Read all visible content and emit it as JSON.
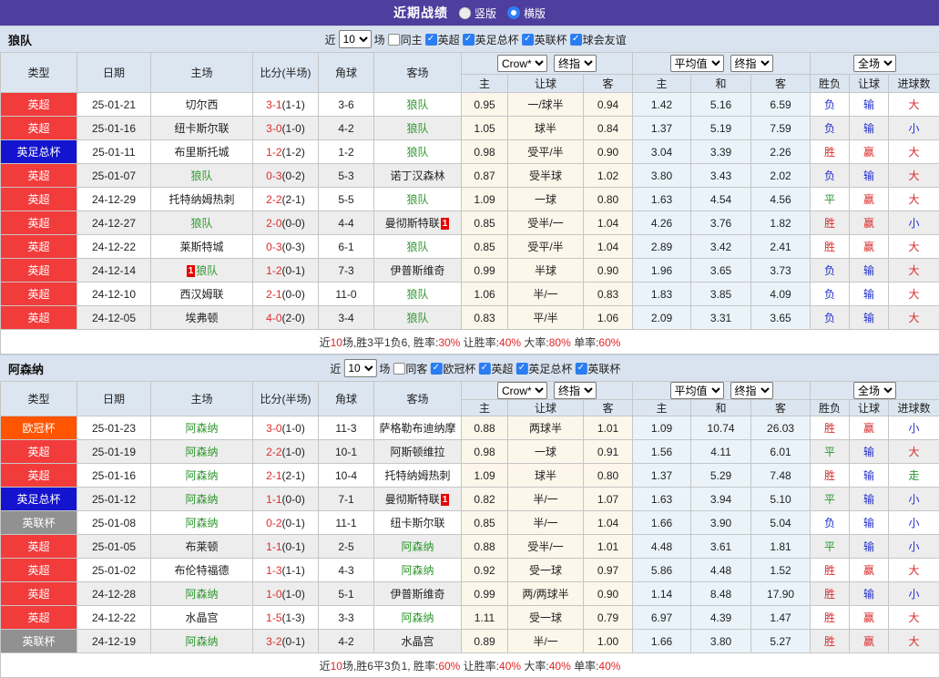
{
  "topbar": {
    "title": "近期战绩",
    "radio_vertical": "竖版",
    "radio_horizontal": "横版",
    "selected_layout": "横版"
  },
  "colors": {
    "accent_purple": "#4e3e9d",
    "section_bar_bg": "#d9e3ef",
    "header_bg": "#dce6f1",
    "row_alt_bg": "#ededed",
    "crow_col_bg": "#fdf6ea",
    "avg_col_bg": "#eaf3fa",
    "score_red": "#e32a2a",
    "focus_team_green": "#2e962e",
    "red_card_bg": "#e60000",
    "checkbox_blue": "#2b7df3",
    "summary_hot": "#e62222",
    "badges": {
      "英超": "#f23b3b",
      "英足总杯": "#1414cf",
      "欧冠杯": "#ff5400",
      "英联杯": "#919191"
    },
    "result_text": {
      "胜": "#d92b2b",
      "平": "#27972c",
      "负": "#2330cc",
      "赢": "#d92b2b",
      "输": "#2330cc",
      "大": "#d92b2b",
      "小": "#2330cc",
      "走": "#27972c"
    }
  },
  "sections": [
    {
      "team": "狼队",
      "controls": {
        "near_label": "近",
        "count": "10",
        "games_label": "场",
        "same_label": "同主",
        "same_checked": false,
        "leagues": [
          "英超",
          "英足总杯",
          "英联杯",
          "球会友谊"
        ]
      },
      "header": {
        "cols": [
          "类型",
          "日期",
          "主场",
          "比分(半场)",
          "角球",
          "客场"
        ],
        "odds_group1": {
          "select1": "Crow*",
          "select2": "终指",
          "subcols": [
            "主",
            "让球",
            "客"
          ]
        },
        "odds_group2": {
          "select1": "平均值",
          "select2": "终指",
          "subcols": [
            "主",
            "和",
            "客"
          ]
        },
        "result_group": {
          "select": "全场",
          "subcols": [
            "胜负",
            "让球",
            "进球数"
          ]
        }
      },
      "rows": [
        {
          "type": "英超",
          "date": "25-01-21",
          "home": {
            "name": "切尔西",
            "focus": false
          },
          "ft": "3-1",
          "ht": "(1-1)",
          "corners": "3-6",
          "away": {
            "name": "狼队",
            "focus": true
          },
          "crow": [
            "0.95",
            "一/球半",
            "0.94"
          ],
          "avg": [
            "1.42",
            "5.16",
            "6.59"
          ],
          "result": [
            "负",
            "输",
            "大"
          ]
        },
        {
          "type": "英超",
          "date": "25-01-16",
          "home": {
            "name": "纽卡斯尔联",
            "focus": false
          },
          "ft": "3-0",
          "ht": "(1-0)",
          "corners": "4-2",
          "away": {
            "name": "狼队",
            "focus": true
          },
          "crow": [
            "1.05",
            "球半",
            "0.84"
          ],
          "avg": [
            "1.37",
            "5.19",
            "7.59"
          ],
          "result": [
            "负",
            "输",
            "小"
          ]
        },
        {
          "type": "英足总杯",
          "date": "25-01-11",
          "home": {
            "name": "布里斯托城",
            "focus": false
          },
          "ft": "1-2",
          "ht": "(1-2)",
          "corners": "1-2",
          "away": {
            "name": "狼队",
            "focus": true
          },
          "crow": [
            "0.98",
            "受平/半",
            "0.90"
          ],
          "avg": [
            "3.04",
            "3.39",
            "2.26"
          ],
          "result": [
            "胜",
            "赢",
            "大"
          ]
        },
        {
          "type": "英超",
          "date": "25-01-07",
          "home": {
            "name": "狼队",
            "focus": true
          },
          "ft": "0-3",
          "ht": "(0-2)",
          "corners": "5-3",
          "away": {
            "name": "诺丁汉森林",
            "focus": false
          },
          "crow": [
            "0.87",
            "受半球",
            "1.02"
          ],
          "avg": [
            "3.80",
            "3.43",
            "2.02"
          ],
          "result": [
            "负",
            "输",
            "大"
          ]
        },
        {
          "type": "英超",
          "date": "24-12-29",
          "home": {
            "name": "托特纳姆热刺",
            "focus": false
          },
          "ft": "2-2",
          "ht": "(2-1)",
          "corners": "5-5",
          "away": {
            "name": "狼队",
            "focus": true
          },
          "crow": [
            "1.09",
            "一球",
            "0.80"
          ],
          "avg": [
            "1.63",
            "4.54",
            "4.56"
          ],
          "result": [
            "平",
            "赢",
            "大"
          ]
        },
        {
          "type": "英超",
          "date": "24-12-27",
          "home": {
            "name": "狼队",
            "focus": true
          },
          "ft": "2-0",
          "ht": "(0-0)",
          "corners": "4-4",
          "away": {
            "name": "曼彻斯特联",
            "focus": false,
            "red": "1",
            "red_pos": "after"
          },
          "crow": [
            "0.85",
            "受半/一",
            "1.04"
          ],
          "avg": [
            "4.26",
            "3.76",
            "1.82"
          ],
          "result": [
            "胜",
            "赢",
            "小"
          ]
        },
        {
          "type": "英超",
          "date": "24-12-22",
          "home": {
            "name": "莱斯特城",
            "focus": false
          },
          "ft": "0-3",
          "ht": "(0-3)",
          "corners": "6-1",
          "away": {
            "name": "狼队",
            "focus": true
          },
          "crow": [
            "0.85",
            "受平/半",
            "1.04"
          ],
          "avg": [
            "2.89",
            "3.42",
            "2.41"
          ],
          "result": [
            "胜",
            "赢",
            "大"
          ]
        },
        {
          "type": "英超",
          "date": "24-12-14",
          "home": {
            "name": "狼队",
            "focus": true,
            "red": "1",
            "red_pos": "before"
          },
          "ft": "1-2",
          "ht": "(0-1)",
          "corners": "7-3",
          "away": {
            "name": "伊普斯维奇",
            "focus": false
          },
          "crow": [
            "0.99",
            "半球",
            "0.90"
          ],
          "avg": [
            "1.96",
            "3.65",
            "3.73"
          ],
          "result": [
            "负",
            "输",
            "大"
          ]
        },
        {
          "type": "英超",
          "date": "24-12-10",
          "home": {
            "name": "西汉姆联",
            "focus": false
          },
          "ft": "2-1",
          "ht": "(0-0)",
          "corners": "11-0",
          "away": {
            "name": "狼队",
            "focus": true
          },
          "crow": [
            "1.06",
            "半/一",
            "0.83"
          ],
          "avg": [
            "1.83",
            "3.85",
            "4.09"
          ],
          "result": [
            "负",
            "输",
            "大"
          ]
        },
        {
          "type": "英超",
          "date": "24-12-05",
          "home": {
            "name": "埃弗顿",
            "focus": false
          },
          "ft": "4-0",
          "ht": "(2-0)",
          "corners": "3-4",
          "away": {
            "name": "狼队",
            "focus": true
          },
          "crow": [
            "0.83",
            "平/半",
            "1.06"
          ],
          "avg": [
            "2.09",
            "3.31",
            "3.65"
          ],
          "result": [
            "负",
            "输",
            "大"
          ]
        }
      ],
      "summary": [
        {
          "t": "近",
          "hot": false
        },
        {
          "t": "10",
          "hot": true
        },
        {
          "t": "场,胜3平1负6, 胜率:",
          "hot": false
        },
        {
          "t": "30%",
          "hot": true
        },
        {
          "t": " 让胜率:",
          "hot": false
        },
        {
          "t": "40%",
          "hot": true
        },
        {
          "t": " 大率:",
          "hot": false
        },
        {
          "t": "80%",
          "hot": true
        },
        {
          "t": " 单率:",
          "hot": false
        },
        {
          "t": "60%",
          "hot": true
        }
      ]
    },
    {
      "team": "阿森纳",
      "controls": {
        "near_label": "近",
        "count": "10",
        "games_label": "场",
        "same_label": "同客",
        "same_checked": false,
        "leagues": [
          "欧冠杯",
          "英超",
          "英足总杯",
          "英联杯"
        ]
      },
      "header": {
        "cols": [
          "类型",
          "日期",
          "主场",
          "比分(半场)",
          "角球",
          "客场"
        ],
        "odds_group1": {
          "select1": "Crow*",
          "select2": "终指",
          "subcols": [
            "主",
            "让球",
            "客"
          ]
        },
        "odds_group2": {
          "select1": "平均值",
          "select2": "终指",
          "subcols": [
            "主",
            "和",
            "客"
          ]
        },
        "result_group": {
          "select": "全场",
          "subcols": [
            "胜负",
            "让球",
            "进球数"
          ]
        }
      },
      "rows": [
        {
          "type": "欧冠杯",
          "date": "25-01-23",
          "home": {
            "name": "阿森纳",
            "focus": true
          },
          "ft": "3-0",
          "ht": "(1-0)",
          "corners": "11-3",
          "away": {
            "name": "萨格勒布迪纳摩",
            "focus": false
          },
          "crow": [
            "0.88",
            "两球半",
            "1.01"
          ],
          "avg": [
            "1.09",
            "10.74",
            "26.03"
          ],
          "result": [
            "胜",
            "赢",
            "小"
          ]
        },
        {
          "type": "英超",
          "date": "25-01-19",
          "home": {
            "name": "阿森纳",
            "focus": true
          },
          "ft": "2-2",
          "ht": "(1-0)",
          "corners": "10-1",
          "away": {
            "name": "阿斯顿维拉",
            "focus": false
          },
          "crow": [
            "0.98",
            "一球",
            "0.91"
          ],
          "avg": [
            "1.56",
            "4.11",
            "6.01"
          ],
          "result": [
            "平",
            "输",
            "大"
          ]
        },
        {
          "type": "英超",
          "date": "25-01-16",
          "home": {
            "name": "阿森纳",
            "focus": true
          },
          "ft": "2-1",
          "ht": "(2-1)",
          "corners": "10-4",
          "away": {
            "name": "托特纳姆热刺",
            "focus": false
          },
          "crow": [
            "1.09",
            "球半",
            "0.80"
          ],
          "avg": [
            "1.37",
            "5.29",
            "7.48"
          ],
          "result": [
            "胜",
            "输",
            "走"
          ]
        },
        {
          "type": "英足总杯",
          "date": "25-01-12",
          "home": {
            "name": "阿森纳",
            "focus": true
          },
          "ft": "1-1",
          "ht": "(0-0)",
          "corners": "7-1",
          "away": {
            "name": "曼彻斯特联",
            "focus": false,
            "red": "1",
            "red_pos": "after"
          },
          "crow": [
            "0.82",
            "半/一",
            "1.07"
          ],
          "avg": [
            "1.63",
            "3.94",
            "5.10"
          ],
          "result": [
            "平",
            "输",
            "小"
          ]
        },
        {
          "type": "英联杯",
          "date": "25-01-08",
          "home": {
            "name": "阿森纳",
            "focus": true
          },
          "ft": "0-2",
          "ht": "(0-1)",
          "corners": "11-1",
          "away": {
            "name": "纽卡斯尔联",
            "focus": false
          },
          "crow": [
            "0.85",
            "半/一",
            "1.04"
          ],
          "avg": [
            "1.66",
            "3.90",
            "5.04"
          ],
          "result": [
            "负",
            "输",
            "小"
          ]
        },
        {
          "type": "英超",
          "date": "25-01-05",
          "home": {
            "name": "布莱顿",
            "focus": false
          },
          "ft": "1-1",
          "ht": "(0-1)",
          "corners": "2-5",
          "away": {
            "name": "阿森纳",
            "focus": true
          },
          "crow": [
            "0.88",
            "受半/一",
            "1.01"
          ],
          "avg": [
            "4.48",
            "3.61",
            "1.81"
          ],
          "result": [
            "平",
            "输",
            "小"
          ]
        },
        {
          "type": "英超",
          "date": "25-01-02",
          "home": {
            "name": "布伦特福德",
            "focus": false
          },
          "ft": "1-3",
          "ht": "(1-1)",
          "corners": "4-3",
          "away": {
            "name": "阿森纳",
            "focus": true
          },
          "crow": [
            "0.92",
            "受一球",
            "0.97"
          ],
          "avg": [
            "5.86",
            "4.48",
            "1.52"
          ],
          "result": [
            "胜",
            "赢",
            "大"
          ]
        },
        {
          "type": "英超",
          "date": "24-12-28",
          "home": {
            "name": "阿森纳",
            "focus": true
          },
          "ft": "1-0",
          "ht": "(1-0)",
          "corners": "5-1",
          "away": {
            "name": "伊普斯维奇",
            "focus": false
          },
          "crow": [
            "0.99",
            "两/两球半",
            "0.90"
          ],
          "avg": [
            "1.14",
            "8.48",
            "17.90"
          ],
          "result": [
            "胜",
            "输",
            "小"
          ]
        },
        {
          "type": "英超",
          "date": "24-12-22",
          "home": {
            "name": "水晶宫",
            "focus": false
          },
          "ft": "1-5",
          "ht": "(1-3)",
          "corners": "3-3",
          "away": {
            "name": "阿森纳",
            "focus": true
          },
          "crow": [
            "1.11",
            "受一球",
            "0.79"
          ],
          "avg": [
            "6.97",
            "4.39",
            "1.47"
          ],
          "result": [
            "胜",
            "赢",
            "大"
          ]
        },
        {
          "type": "英联杯",
          "date": "24-12-19",
          "home": {
            "name": "阿森纳",
            "focus": true
          },
          "ft": "3-2",
          "ht": "(0-1)",
          "corners": "4-2",
          "away": {
            "name": "水晶宫",
            "focus": false
          },
          "crow": [
            "0.89",
            "半/一",
            "1.00"
          ],
          "avg": [
            "1.66",
            "3.80",
            "5.27"
          ],
          "result": [
            "胜",
            "赢",
            "大"
          ]
        }
      ],
      "summary": [
        {
          "t": "近",
          "hot": false
        },
        {
          "t": "10",
          "hot": true
        },
        {
          "t": "场,胜6平3负1, 胜率:",
          "hot": false
        },
        {
          "t": "60%",
          "hot": true
        },
        {
          "t": " 让胜率:",
          "hot": false
        },
        {
          "t": "40%",
          "hot": true
        },
        {
          "t": " 大率:",
          "hot": false
        },
        {
          "t": "40%",
          "hot": true
        },
        {
          "t": " 单率:",
          "hot": false
        },
        {
          "t": "40%",
          "hot": true
        }
      ]
    }
  ]
}
